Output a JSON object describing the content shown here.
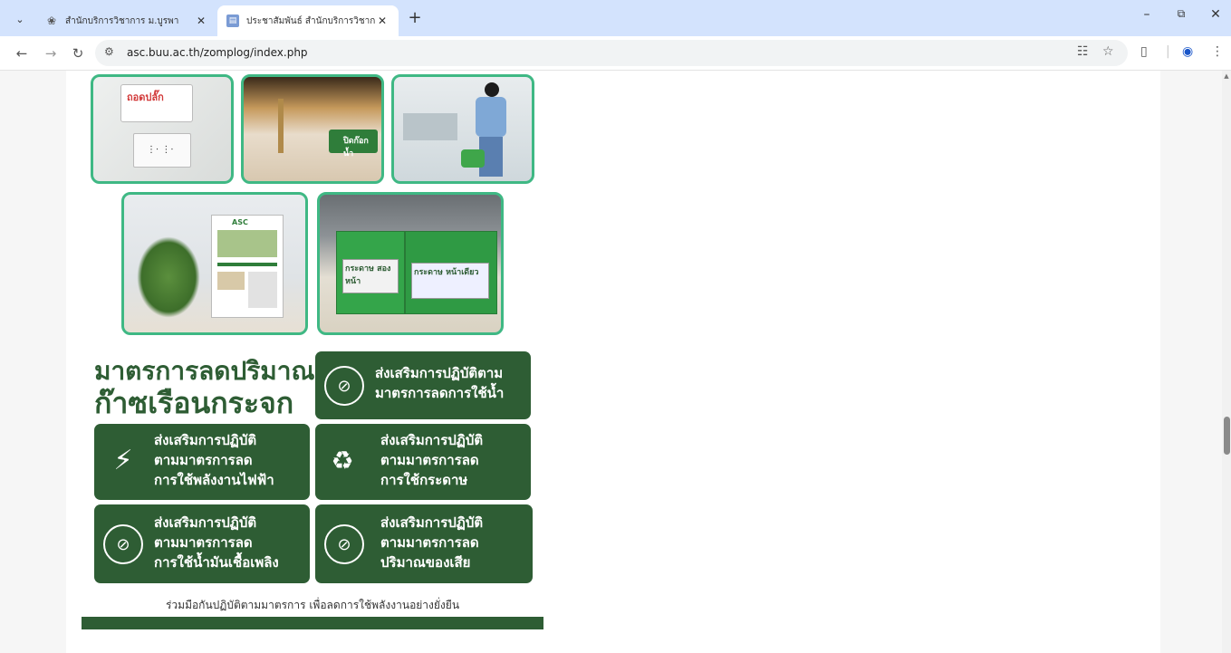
{
  "browser": {
    "tabs": [
      {
        "title": "สำนักบริการวิชาการ ม.บูรพา",
        "active": false
      },
      {
        "title": "ประชาสัมพันธ์ สำนักบริการวิชาการ",
        "active": true
      }
    ],
    "url": "asc.buu.ac.th/zomplog/index.php"
  },
  "poster": {
    "photo_labels": {
      "plug_sign": "ถอดปลั๊ก",
      "tap_sign": "ปิดก๊อกน้ำ",
      "box_left": "กระดาษ สองหน้า",
      "box_right": "กระดาษ หน้าเดียว",
      "board_title": "ASC"
    },
    "headline_line1": "มาตรการลดปริมาณ",
    "headline_line2": "ก๊าซเรือนกระจก",
    "cards": [
      {
        "line1": "ส่งเสริมการปฏิบัติตาม",
        "line2": "มาตรการลดการใช้น้ำ",
        "line3": ""
      },
      {
        "line1": "ส่งเสริมการปฏิบัติ",
        "line2": "ตามมาตรการลด",
        "line3": "การใช้พลังงานไฟฟ้า"
      },
      {
        "line1": "ส่งเสริมการปฏิบัติ",
        "line2": "ตามมาตรการลด",
        "line3": "การใช้กระดาษ"
      },
      {
        "line1": "ส่งเสริมการปฏิบัติ",
        "line2": "ตามมาตรการลด",
        "line3": "การใช้น้ำมันเชื้อเพลิง"
      },
      {
        "line1": "ส่งเสริมการปฏิบัติ",
        "line2": "ตามมาตรการลด",
        "line3": "ปริมาณของเสีย"
      }
    ],
    "footer": "ร่วมมือกันปฏิบัติตามมาตรการ เพื่อลดการใช้พลังงานอย่างยั่งยืน"
  },
  "colors": {
    "brand_green": "#2e5d34",
    "photo_border": "#3fb884",
    "tabbar": "#d3e3fd"
  }
}
